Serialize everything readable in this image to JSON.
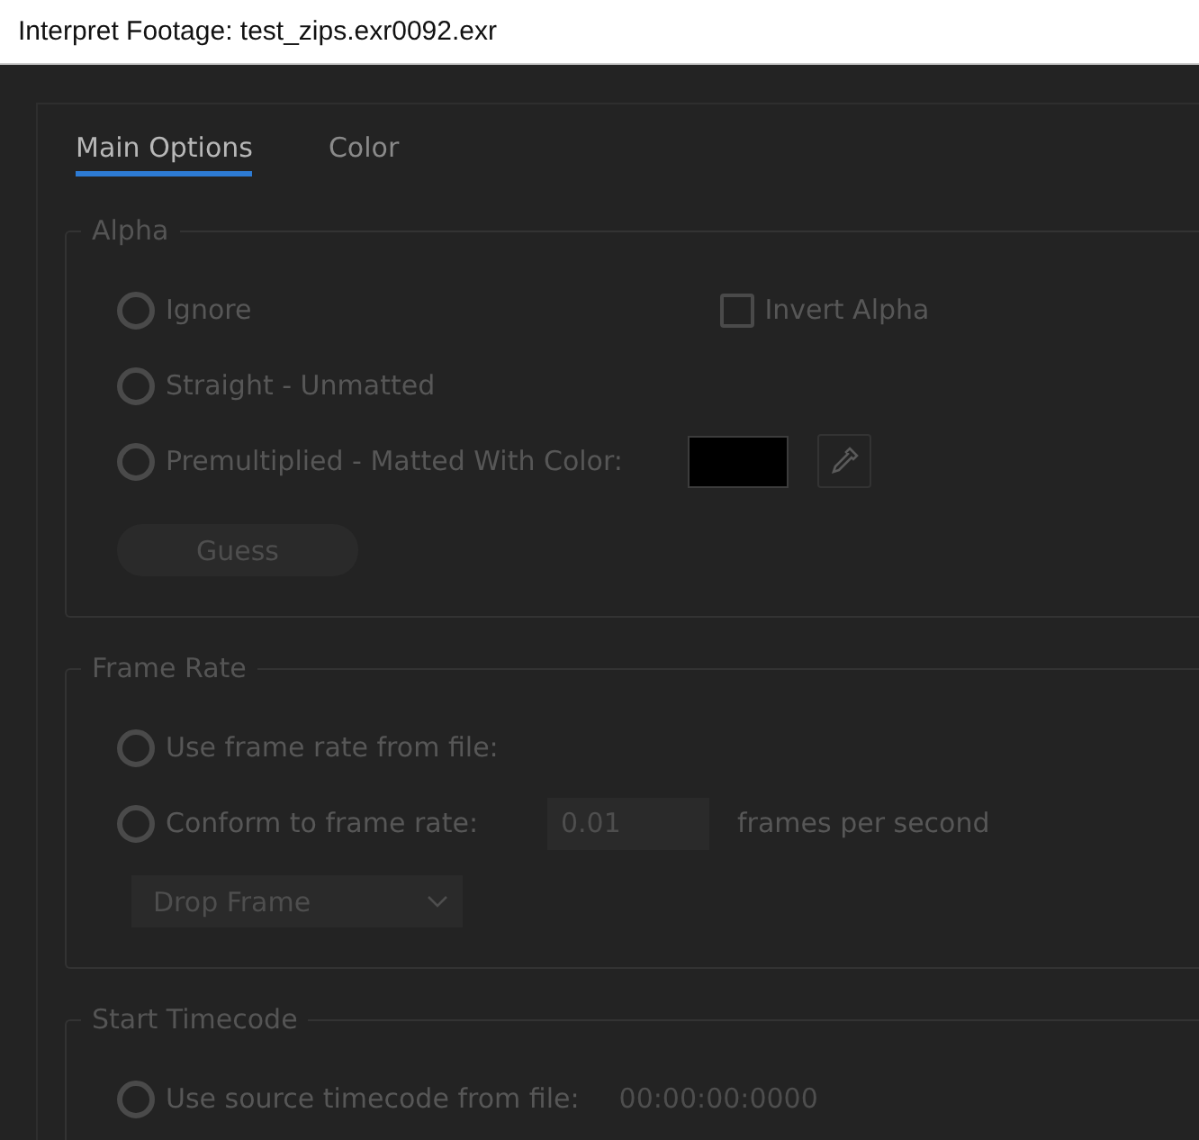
{
  "window": {
    "title": "Interpret Footage: test_zips.exr0092.exr"
  },
  "tabs": [
    {
      "label": "Main Options",
      "selected": true
    },
    {
      "label": "Color",
      "selected": false
    }
  ],
  "alpha": {
    "legend": "Alpha",
    "options": [
      {
        "label": "Ignore",
        "selected": false
      },
      {
        "label": "Straight - Unmatted",
        "selected": false
      },
      {
        "label": "Premultiplied - Matted With Color:",
        "selected": false
      }
    ],
    "invert_alpha": {
      "label": "Invert Alpha",
      "checked": false
    },
    "guess_button": "Guess"
  },
  "frame_rate": {
    "legend": "Frame Rate",
    "options": [
      {
        "label": "Use frame rate from file:",
        "selected": false
      },
      {
        "label": "Conform to frame rate:",
        "selected": false
      }
    ],
    "rate_field": {
      "value": "0.01"
    },
    "unit": "frames per second",
    "drop_frame": {
      "value": "Drop Frame"
    }
  },
  "start_timecode": {
    "legend": "Start Timecode",
    "options": [
      {
        "label": "Use source timecode from file:",
        "selected": false
      }
    ],
    "timecode": "00:00:00:0000"
  }
}
